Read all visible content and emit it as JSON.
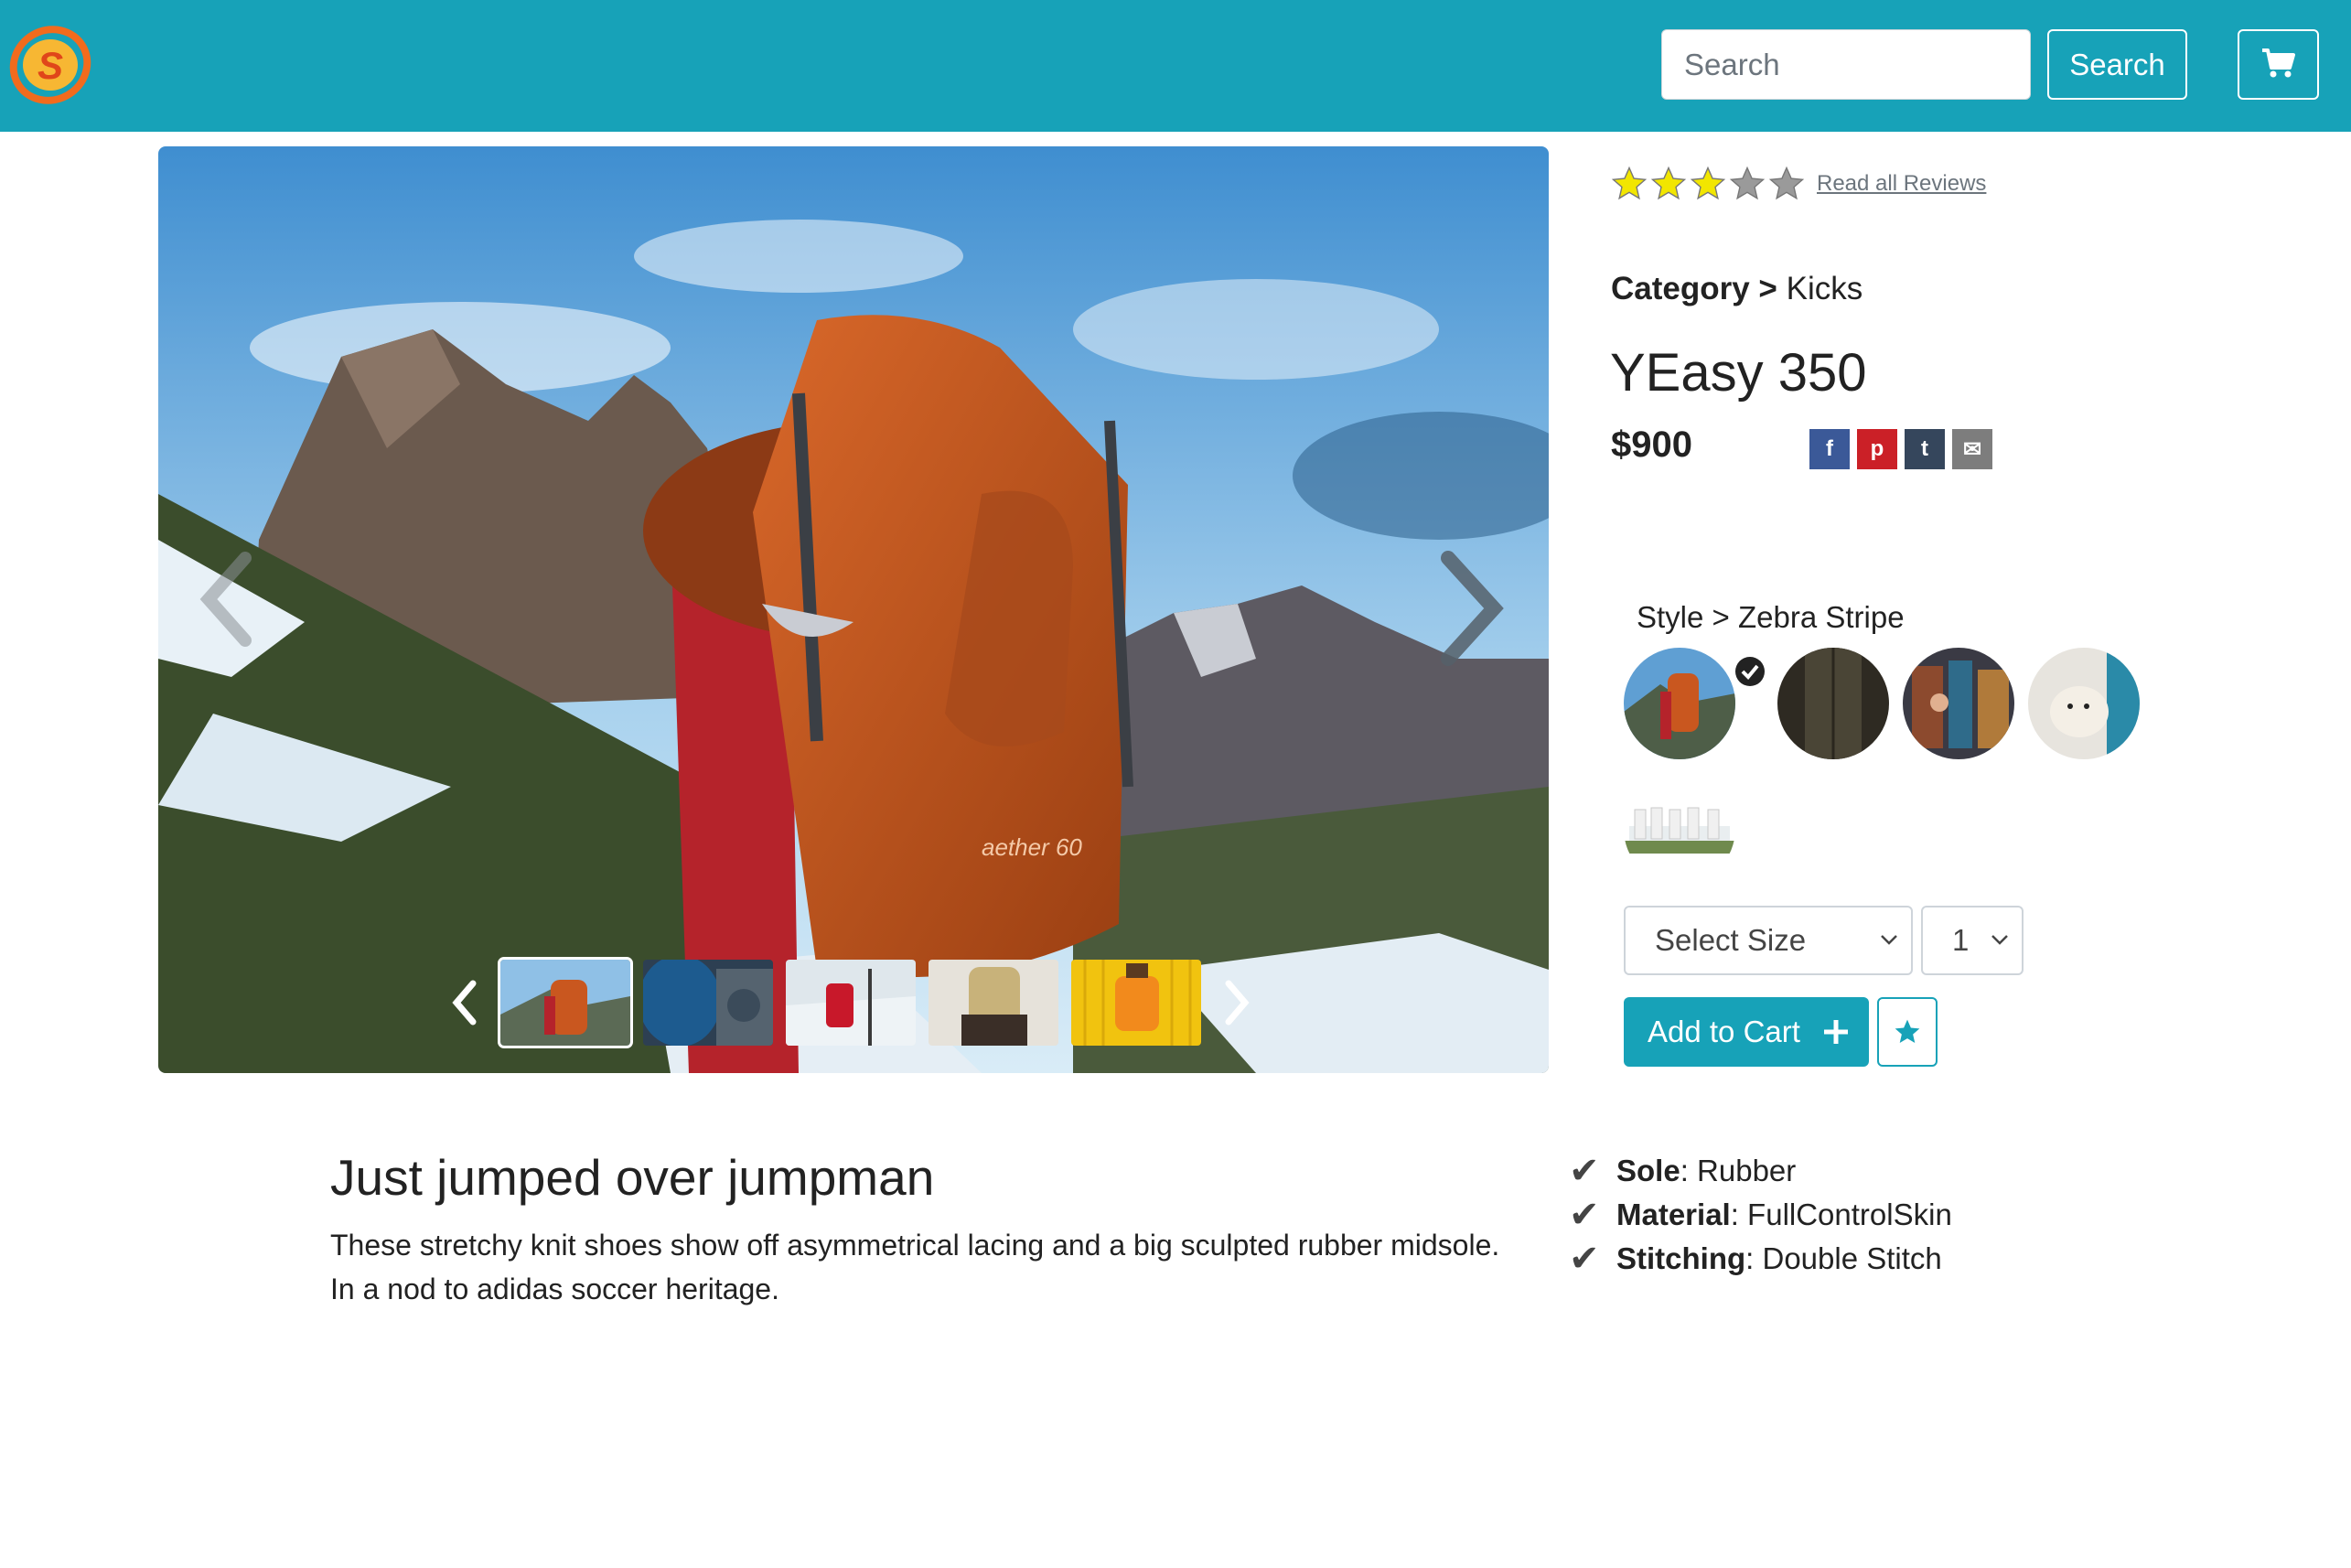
{
  "header": {
    "logo_letter": "S",
    "search_placeholder": "Search",
    "search_button": "Search",
    "cart_icon": "shopping-cart-icon",
    "brand_color": "#17a2b8"
  },
  "product": {
    "rating": {
      "value": 3,
      "max": 5,
      "reviews_link": "Read all Reviews"
    },
    "category_label": "Category >",
    "category_value": "Kicks",
    "title": "YEasy 350",
    "price": "$900",
    "share": [
      {
        "icon": "facebook-icon",
        "glyph": "f",
        "color": "#3b5998"
      },
      {
        "icon": "pinterest-icon",
        "glyph": "p",
        "color": "#cb2027"
      },
      {
        "icon": "tumblr-icon",
        "glyph": "t",
        "color": "#35465c"
      },
      {
        "icon": "email-icon",
        "glyph": "✉",
        "color": "#7d7d7d"
      }
    ],
    "style_label": "Style > Zebra Stripe",
    "styles": [
      {
        "name": "hiker",
        "selected": true
      },
      {
        "name": "dark"
      },
      {
        "name": "shop"
      },
      {
        "name": "dog"
      },
      {
        "name": "group"
      }
    ],
    "size_select": "Select Size",
    "quantity": "1",
    "add_to_cart": "Add to Cart"
  },
  "gallery": {
    "active_index": 0,
    "thumbnails": [
      "hiker-orange-pack",
      "blue-jacket",
      "red-pack-snow",
      "tan-pack",
      "yellow-pack"
    ]
  },
  "description": {
    "heading": "Just jumped over jumpman",
    "lines": [
      "These stretchy knit shoes show off asymmetrical lacing and a big sculpted rubber midsole.",
      "In a nod to adidas soccer heritage."
    ]
  },
  "features": [
    {
      "label": "Sole",
      "value": " : Rubber"
    },
    {
      "label": "Material",
      "value": " : FullControlSkin"
    },
    {
      "label": "Stitching",
      "value": " : Double Stitch"
    }
  ]
}
